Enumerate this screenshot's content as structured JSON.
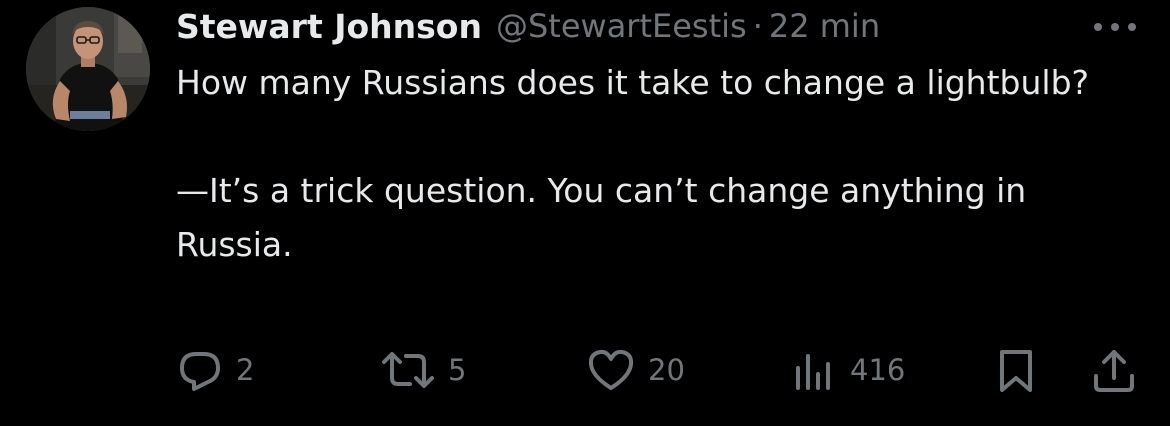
{
  "tweet": {
    "display_name": "Stewart Johnson",
    "handle": "@StewartEestis",
    "separator": "·",
    "time": "22 min",
    "more_icon": "more-icon",
    "text": "How many Russians does it take to change a lightbulb?\n\n—It’s a trick question. You can’t change anything in Russia."
  },
  "actions": {
    "replies": {
      "icon": "reply-icon",
      "count": "2"
    },
    "retweets": {
      "icon": "retweet-icon",
      "count": "5"
    },
    "likes": {
      "icon": "heart-icon",
      "count": "20"
    },
    "views": {
      "icon": "views-icon",
      "count": "416"
    },
    "bookmark": {
      "icon": "bookmark-icon"
    },
    "share": {
      "icon": "share-icon"
    }
  },
  "colors": {
    "background": "#000000",
    "primary_text": "#e7e9ea",
    "secondary_text": "#71767b"
  }
}
